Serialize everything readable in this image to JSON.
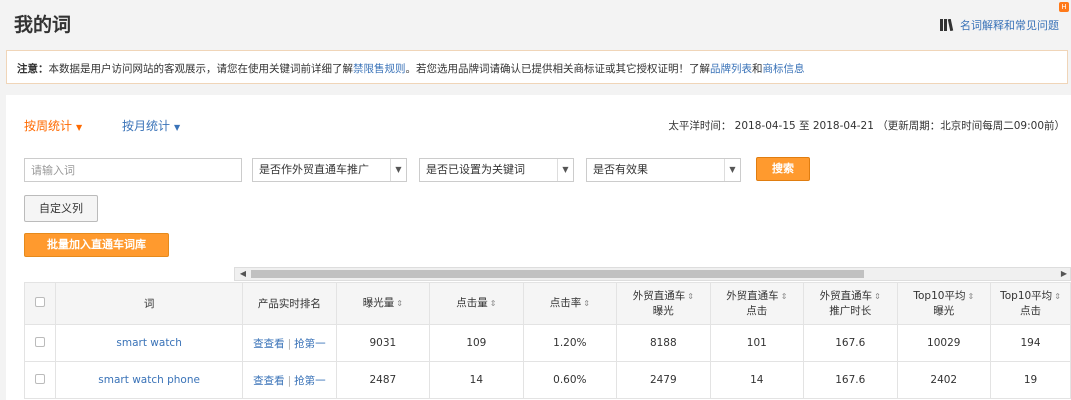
{
  "header": {
    "title": "我的词",
    "help_label": "名词解释和常见问题"
  },
  "notice": {
    "label": "注意：",
    "text1": "本数据是用户访问网站的客观展示，请您在使用关键词前详细了解",
    "link1": "禁限售规则",
    "text2": "。若您选用品牌词请确认已提供相关商标证或其它授权证明！了解",
    "link2": "品牌列表",
    "text3": "和",
    "link3": "商标信息"
  },
  "tabs": [
    {
      "label": "按周统计",
      "active": true
    },
    {
      "label": "按月统计",
      "active": false
    }
  ],
  "time_info": "太平洋时间： 2018-04-15 至 2018-04-21 （更新周期：北京时间每周二09:00前）",
  "filters": {
    "search_placeholder": "请输入词",
    "select1": "是否作外贸直通车推广",
    "select2": "是否已设置为关键词",
    "select3": "是否有效果",
    "search_button": "搜索"
  },
  "actions": {
    "custom_columns": "自定义列",
    "batch_add": "批量加入直通车词库"
  },
  "table": {
    "columns": {
      "word": "词",
      "rank": "产品实时排名",
      "impressions": "曝光量",
      "clicks": "点击量",
      "ctr": "点击率",
      "p4p_impressions_1": "外贸直通车",
      "p4p_impressions_2": "曝光",
      "p4p_clicks_1": "外贸直通车",
      "p4p_clicks_2": "点击",
      "p4p_duration_1": "外贸直通车",
      "p4p_duration_2": "推广时长",
      "top10_impr_1": "Top10平均",
      "top10_impr_2": "曝光",
      "top10_clicks_1": "Top10平均",
      "top10_clicks_2": "点击"
    },
    "rank_view": "查查看",
    "rank_first": "抢第一",
    "rows": [
      {
        "word": "smart watch",
        "impressions": "9031",
        "clicks": "109",
        "ctr": "1.20%",
        "p4p_impressions": "8188",
        "p4p_clicks": "101",
        "p4p_duration": "167.6",
        "top10_impr": "10029",
        "top10_clicks": "194"
      },
      {
        "word": "smart watch phone",
        "impressions": "2487",
        "clicks": "14",
        "ctr": "0.60%",
        "p4p_impressions": "2479",
        "p4p_clicks": "14",
        "p4p_duration": "167.6",
        "top10_impr": "2402",
        "top10_clicks": "19"
      }
    ]
  },
  "colors": {
    "accent_orange": "#ff9a2e",
    "link_blue": "#3a73b8",
    "active_tab": "#ff6a00"
  }
}
